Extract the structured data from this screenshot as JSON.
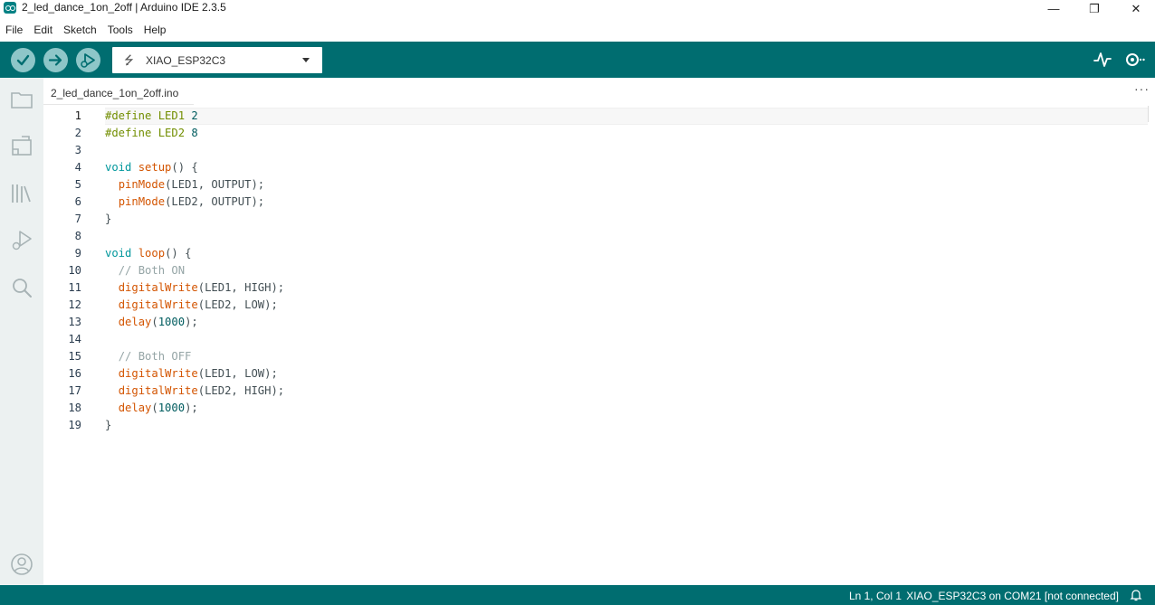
{
  "window": {
    "title": "2_led_dance_1on_2off | Arduino IDE 2.3.5",
    "minimize": "—",
    "maximize": "❐",
    "close": "✕"
  },
  "menu": [
    "File",
    "Edit",
    "Sketch",
    "Tools",
    "Help"
  ],
  "toolbar": {
    "board": "XIAO_ESP32C3",
    "verify_icon": "check-icon",
    "upload_icon": "arrow-right-icon",
    "debug_icon": "debug-icon",
    "plotter_icon": "serial-plotter-icon",
    "monitor_icon": "serial-monitor-icon"
  },
  "tabs": [
    {
      "label": "2_led_dance_1on_2off.ino"
    }
  ],
  "tab_more": "···",
  "editor": {
    "lines": [
      "#define LED1 2",
      "#define LED2 8",
      "",
      "void setup() {",
      "  pinMode(LED1, OUTPUT);",
      "  pinMode(LED2, OUTPUT);",
      "}",
      "",
      "void loop() {",
      "  // Both ON",
      "  digitalWrite(LED1, HIGH);",
      "  digitalWrite(LED2, LOW);",
      "  delay(1000);",
      "",
      "  // Both OFF",
      "  digitalWrite(LED1, LOW);",
      "  digitalWrite(LED2, HIGH);",
      "  delay(1000);",
      "}"
    ]
  },
  "status": {
    "position": "Ln 1, Col 1",
    "port": "XIAO_ESP32C3 on COM21 [not connected]"
  },
  "colors": {
    "toolbar": "#006d70",
    "button": "#8ec6c8",
    "sidebar": "#ecf1f1",
    "keyword": "#728e00",
    "function": "#d35400",
    "comment": "#95a5a6"
  }
}
